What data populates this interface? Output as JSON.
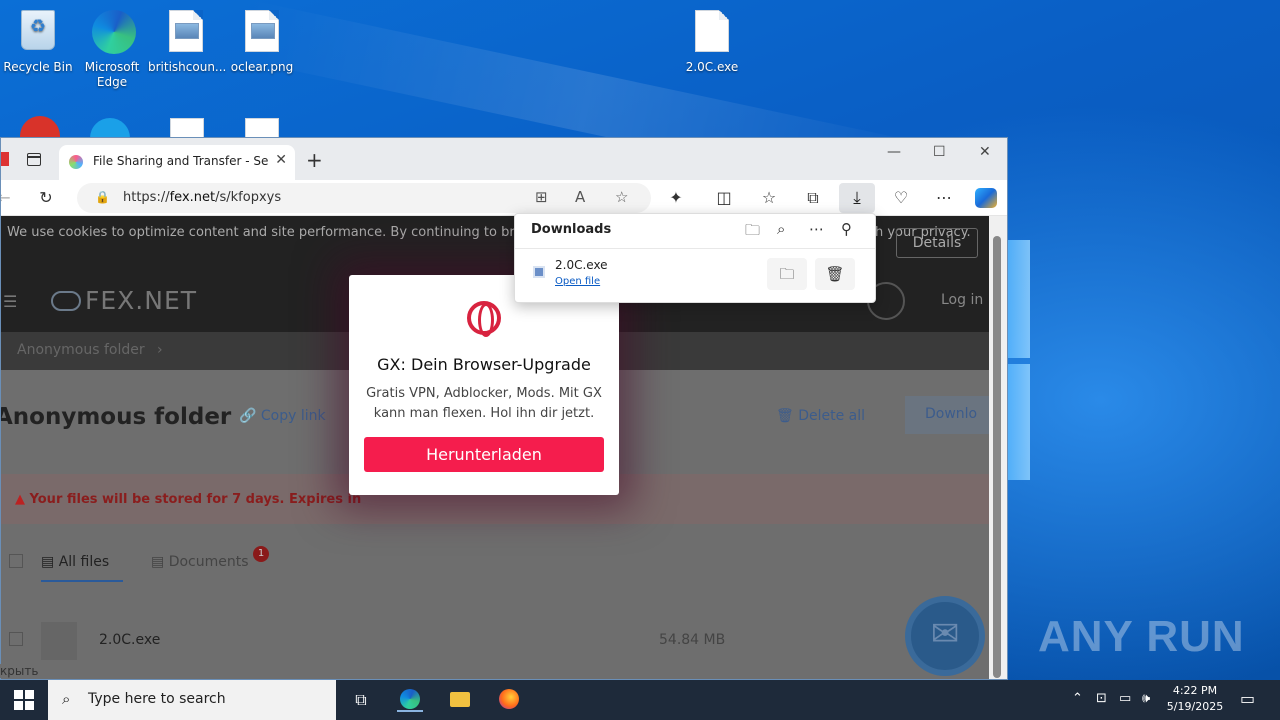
{
  "desktop": {
    "icons": [
      {
        "label": "Recycle Bin"
      },
      {
        "label": "Microsoft Edge"
      },
      {
        "label": "britishcoun..."
      },
      {
        "label": "oclear.png"
      },
      {
        "label": "2.0C.exe"
      }
    ],
    "watermark": "ANY RUN"
  },
  "browser": {
    "tab_title": "File Sharing and Transfer - Send L",
    "url_prefix": "https://",
    "url_domain": "fex.net",
    "url_path": "/s/kfopxys",
    "window_controls": {
      "minimize": "—",
      "maximize": "☐",
      "close": "✕"
    }
  },
  "page": {
    "cookie_text": "We use cookies to optimize content and site performance. By continuing to browse, you agree to the use of cookies that interfere with your privacy.",
    "details_button": "Details",
    "logo": "FEX.NET",
    "login": "Log in",
    "breadcrumb": "Anonymous folder",
    "folder_title": "Anonymous folder",
    "copy_link": "Copy link",
    "delete_all": "Delete all",
    "download": "Downlo",
    "expires_text": "Your files will be stored for 7 days. Expires in",
    "tab_all_files": "All files",
    "tab_documents": "Documents",
    "documents_badge": "1",
    "file_name": "2.0C.exe",
    "file_size": "54.84 MB",
    "hide_label": "крыть"
  },
  "popup": {
    "title": "GX: Dein Browser-Upgrade",
    "text": "Gratis VPN, Adblocker, Mods. Mit GX kann man flexen. Hol ihn dir jetzt.",
    "button": "Herunterladen"
  },
  "downloads": {
    "title": "Downloads",
    "file_name": "2.0C.exe",
    "open_file": "Open file"
  },
  "taskbar": {
    "search_placeholder": "Type here to search",
    "time": "4:22 PM",
    "date": "5/19/2025"
  }
}
